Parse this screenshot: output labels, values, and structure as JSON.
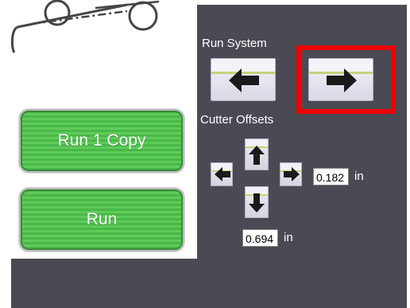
{
  "buttons": {
    "run_copy_label": "Run 1 Copy",
    "run_label": "Run"
  },
  "panel": {
    "run_system_label": "Run System",
    "cutter_offsets_label": "Cutter Offsets"
  },
  "offsets": {
    "x_value": "0.182",
    "y_value": "0.694",
    "unit": "in"
  },
  "icons": {
    "run_back": "arrow-left-icon",
    "run_forward": "arrow-right-icon",
    "offset_left": "arrow-left-icon",
    "offset_up": "arrow-up-icon",
    "offset_down": "arrow-down-icon",
    "offset_right": "arrow-right-icon"
  },
  "colors": {
    "panel_bg": "#4a4a55",
    "button_green": "#4fbd4e",
    "highlight_red": "#ee0000"
  }
}
